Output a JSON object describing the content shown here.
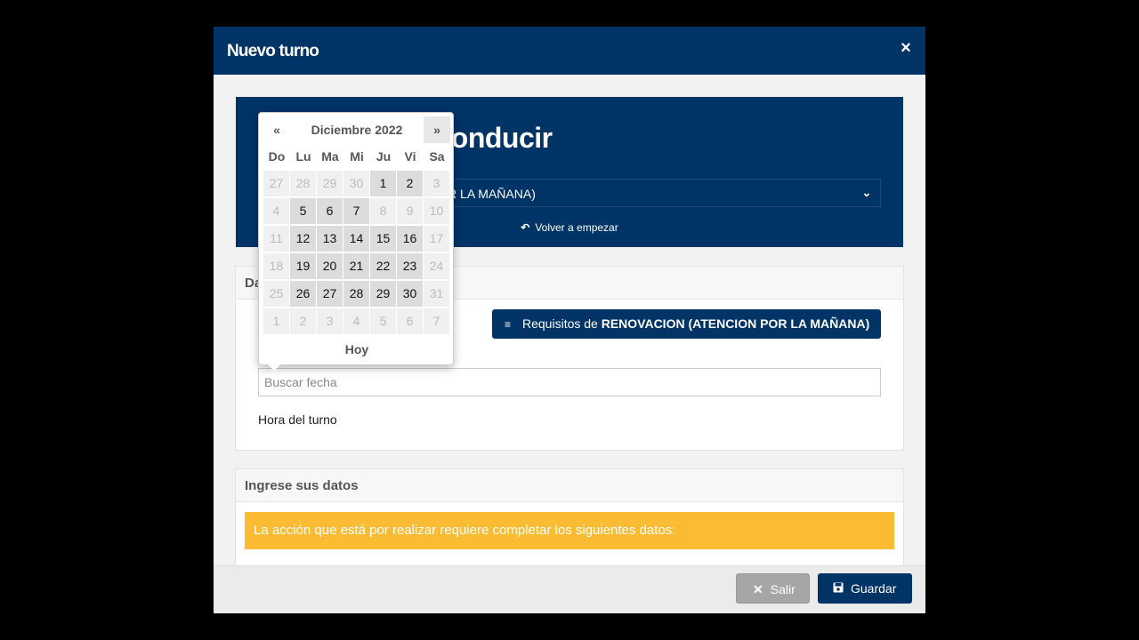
{
  "modal": {
    "title": "Nuevo turno",
    "close_icon": "×"
  },
  "hero": {
    "title": "Licencias de conducir",
    "service_value": "RENOVACION (ATENCION POR LA MAÑANA)",
    "restart_icon": "↶",
    "restart_label": "Volver a empezar"
  },
  "turno_panel": {
    "heading": "Datos del turno",
    "requirements_icon": "≡",
    "requirements_prefix": "Requisitos de",
    "requirements_bold": "RENOVACION (ATENCION POR LA MAÑANA)",
    "date_placeholder": "Buscar fecha",
    "hour_label": "Hora del turno"
  },
  "datos_panel": {
    "heading": "Ingrese sus datos",
    "alert": "La acción que está por realizar requiere completar los siguientes datos:"
  },
  "footer": {
    "cancel_icon": "✕",
    "cancel_label": "Salir",
    "save_icon": "💾",
    "save_label": "Guardar"
  },
  "datepicker": {
    "prev": "«",
    "next": "»",
    "month_title": "Diciembre 2022",
    "weekdays": [
      "Do",
      "Lu",
      "Ma",
      "Mi",
      "Ju",
      "Vi",
      "Sa"
    ],
    "weeks": [
      [
        {
          "d": "27",
          "s": "dis"
        },
        {
          "d": "28",
          "s": "dis"
        },
        {
          "d": "29",
          "s": "dis"
        },
        {
          "d": "30",
          "s": "dis"
        },
        {
          "d": "1",
          "s": "av"
        },
        {
          "d": "2",
          "s": "av"
        },
        {
          "d": "3",
          "s": "dis"
        }
      ],
      [
        {
          "d": "4",
          "s": "dis"
        },
        {
          "d": "5",
          "s": "av"
        },
        {
          "d": "6",
          "s": "av"
        },
        {
          "d": "7",
          "s": "av"
        },
        {
          "d": "8",
          "s": "dis"
        },
        {
          "d": "9",
          "s": "dis"
        },
        {
          "d": "10",
          "s": "dis"
        }
      ],
      [
        {
          "d": "11",
          "s": "dis"
        },
        {
          "d": "12",
          "s": "av"
        },
        {
          "d": "13",
          "s": "av"
        },
        {
          "d": "14",
          "s": "av"
        },
        {
          "d": "15",
          "s": "av"
        },
        {
          "d": "16",
          "s": "av"
        },
        {
          "d": "17",
          "s": "dis"
        }
      ],
      [
        {
          "d": "18",
          "s": "dis"
        },
        {
          "d": "19",
          "s": "av"
        },
        {
          "d": "20",
          "s": "av"
        },
        {
          "d": "21",
          "s": "av"
        },
        {
          "d": "22",
          "s": "av"
        },
        {
          "d": "23",
          "s": "av"
        },
        {
          "d": "24",
          "s": "dis"
        }
      ],
      [
        {
          "d": "25",
          "s": "dis"
        },
        {
          "d": "26",
          "s": "av"
        },
        {
          "d": "27",
          "s": "av"
        },
        {
          "d": "28",
          "s": "av"
        },
        {
          "d": "29",
          "s": "av"
        },
        {
          "d": "30",
          "s": "av"
        },
        {
          "d": "31",
          "s": "dis"
        }
      ],
      [
        {
          "d": "1",
          "s": "dis"
        },
        {
          "d": "2",
          "s": "dis"
        },
        {
          "d": "3",
          "s": "dis"
        },
        {
          "d": "4",
          "s": "dis"
        },
        {
          "d": "5",
          "s": "dis"
        },
        {
          "d": "6",
          "s": "dis"
        },
        {
          "d": "7",
          "s": "dis"
        }
      ]
    ],
    "today_label": "Hoy"
  },
  "colors": {
    "brand": "#003366",
    "alert": "#fbbc33",
    "available_day": "#dcdcdc",
    "disabled_day": "#f0f0f0"
  }
}
